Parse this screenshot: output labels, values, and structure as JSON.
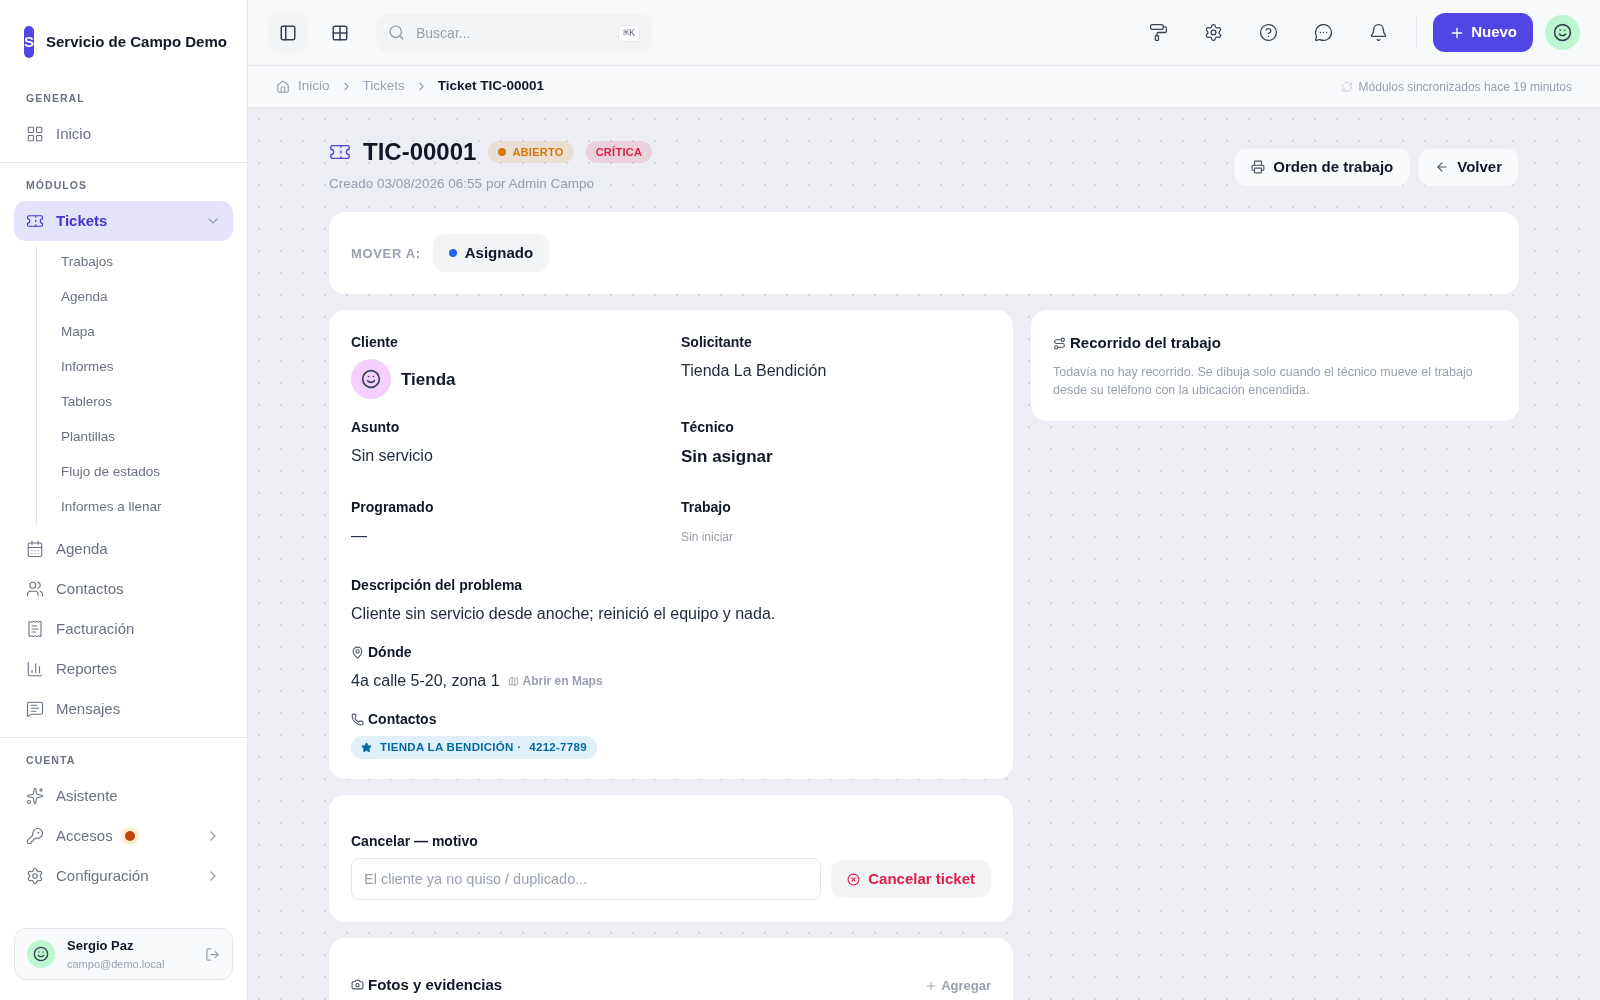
{
  "brand": {
    "logo": "S",
    "name": "Servicio de Campo Demo"
  },
  "sidebar": {
    "sections": [
      {
        "title": "GENERAL",
        "items": [
          {
            "label": "Inicio",
            "selected": false
          }
        ]
      },
      {
        "title": "MÓDULOS",
        "items": [
          {
            "label": "Tickets",
            "selected": true,
            "expanded": true,
            "children": [
              {
                "label": "Trabajos"
              },
              {
                "label": "Agenda"
              },
              {
                "label": "Mapa"
              },
              {
                "label": "Informes"
              },
              {
                "label": "Tableros"
              },
              {
                "label": "Plantillas"
              },
              {
                "label": "Flujo de estados"
              },
              {
                "label": "Informes a llenar"
              }
            ]
          },
          {
            "label": "Agenda",
            "selected": false
          },
          {
            "label": "Contactos",
            "selected": false
          },
          {
            "label": "Facturación",
            "selected": false
          },
          {
            "label": "Reportes",
            "selected": false
          },
          {
            "label": "Mensajes",
            "selected": false
          }
        ]
      },
      {
        "title": "CUENTA",
        "items": [
          {
            "label": "Asistente",
            "selected": false
          },
          {
            "label": "Accesos",
            "selected": false,
            "badge": true,
            "submenu": true
          },
          {
            "label": "Configuración",
            "selected": false,
            "submenu": true
          }
        ]
      }
    ],
    "user": {
      "name": "Sergio Paz",
      "email": "campo@demo.local"
    }
  },
  "topbar": {
    "search": {
      "placeholder": "Buscar...",
      "shortcut": "⌘K"
    },
    "new_button": "Nuevo"
  },
  "breadcrumb": [
    "Inicio",
    "Tickets",
    "Ticket TIC-00001"
  ],
  "sync_status": "Módulos sincronizados hace 19 minutos",
  "ticket": {
    "id": "TIC-00001",
    "badges": [
      {
        "label": "ABIERTO",
        "color": "#d97706",
        "dot": true
      },
      {
        "label": "CRÍTICA",
        "color": "#e11d48",
        "dot": false
      }
    ],
    "created": "Creado 03/08/2026 06:55 por Admin Campo",
    "actions": [
      "Orden de trabajo",
      "Volver"
    ],
    "move_to": {
      "label": "MOVER A:",
      "options": [
        {
          "label": "Asignado",
          "color": "#2563eb"
        }
      ]
    },
    "fields": [
      {
        "label": "Cliente",
        "value": "Tienda",
        "kind": "avatar"
      },
      {
        "label": "Solicitante",
        "value": "Tienda La Bendición",
        "kind": "text"
      },
      {
        "label": "Asunto",
        "value": "Sin servicio",
        "kind": "text"
      },
      {
        "label": "Técnico",
        "value": "Sin asignar",
        "kind": "strong"
      },
      {
        "label": "Programado",
        "value": "—",
        "kind": "text"
      },
      {
        "label": "Trabajo",
        "value": "Sin iniciar",
        "kind": "muted"
      }
    ],
    "description": {
      "label": "Descripción del problema",
      "value": "Cliente sin servicio desde anoche; reinició el equipo y nada."
    },
    "location": {
      "label": "Dónde",
      "value": "4a calle 5-20, zona 1",
      "link": "Abrir en Maps"
    },
    "contacts": {
      "label": "Contactos",
      "items": [
        {
          "name": "TIENDA LA BENDICIÓN ·",
          "phone": "4212-7789",
          "starred": true
        }
      ]
    },
    "cancel": {
      "label": "Cancelar — motivo",
      "placeholder": "El cliente ya no quiso / duplicado...",
      "button": "Cancelar ticket"
    },
    "photos": {
      "title": "Fotos y evidencias",
      "add": "Agregar"
    },
    "route": {
      "title": "Recorrido del trabajo",
      "text": "Todavía no hay recorrido. Se dibuja solo cuando el técnico mueve el trabajo desde su teléfono con la ubicación encendida."
    }
  }
}
